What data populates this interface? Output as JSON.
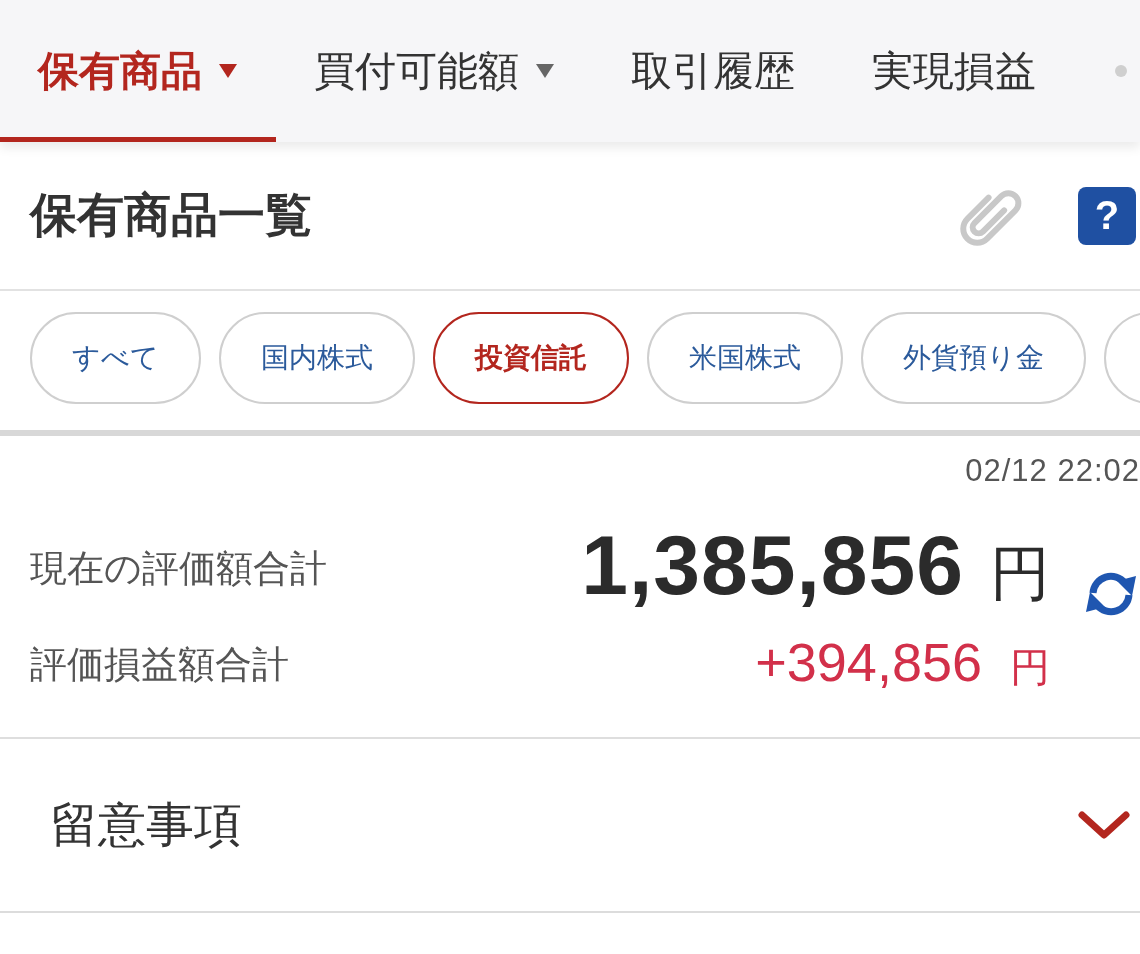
{
  "tabs": [
    {
      "label": "保有商品",
      "has_menu": true,
      "selected": true
    },
    {
      "label": "買付可能額",
      "has_menu": true,
      "selected": false
    },
    {
      "label": "取引履歴",
      "has_menu": false,
      "selected": false
    },
    {
      "label": "実現損益",
      "has_menu": false,
      "selected": false
    }
  ],
  "header": {
    "title": "保有商品一覧",
    "help_button": "?"
  },
  "filter_chips": [
    {
      "label": "すべて",
      "selected": false
    },
    {
      "label": "国内株式",
      "selected": false
    },
    {
      "label": "投資信託",
      "selected": true
    },
    {
      "label": "米国株式",
      "selected": false
    },
    {
      "label": "外貨預り金",
      "selected": false
    },
    {
      "selected": false
    }
  ],
  "summary": {
    "updated_at": "02/12 22:02",
    "rows": [
      {
        "kind": "total",
        "label": "現在の評価額合計",
        "value": "1,385,856",
        "unit": "円"
      },
      {
        "kind": "gain",
        "label": "評価損益額合計",
        "value": "+394,856",
        "unit": "円"
      }
    ]
  },
  "notes_section": {
    "title": "留意事項",
    "expanded": false
  }
}
